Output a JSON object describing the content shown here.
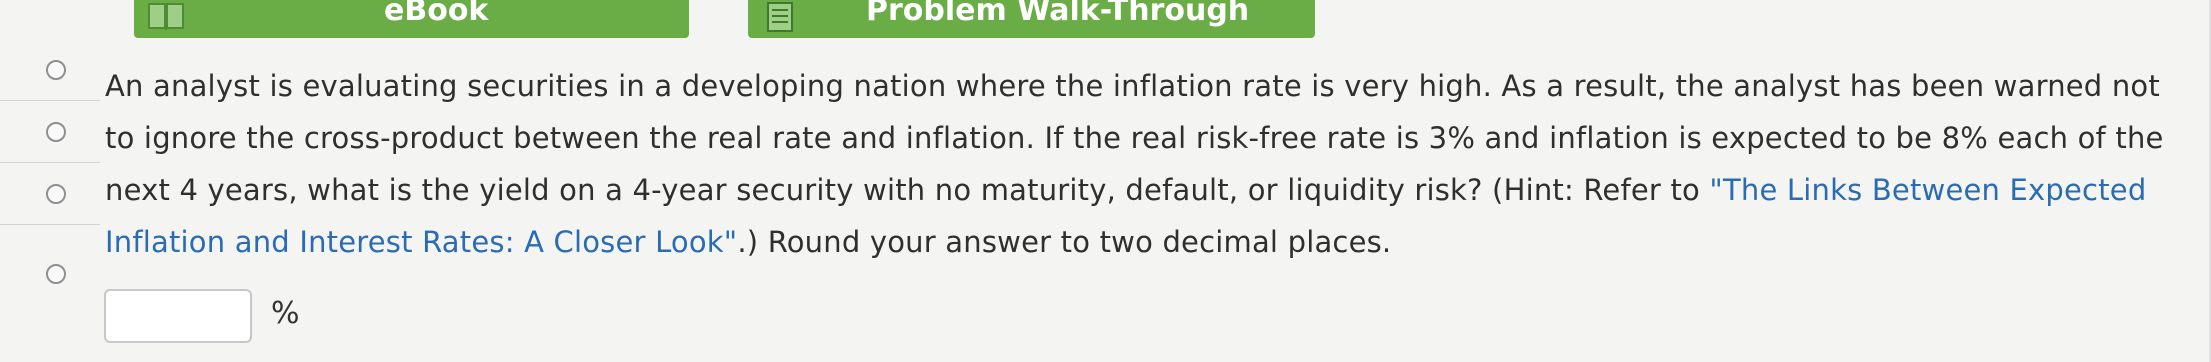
{
  "toolbar": {
    "ebook_label": "eBook",
    "walkthrough_label": "Problem Walk-Through"
  },
  "question": {
    "text_before_link": "An analyst is evaluating securities in a developing nation where the inflation rate is very high. As a result, the analyst has been warned not to ignore the cross-product between the real rate and inflation. If the real risk-free rate is 3% and inflation is expected to be 8% each of the next 4 years, what is the yield on a 4-year security with no maturity, default, or liquidity risk? (Hint: Refer to ",
    "link_text": "\"The Links Between Expected Inflation and Interest Rates: A Closer Look\"",
    "text_after_link": ".) Round your answer to two decimal places."
  },
  "answer": {
    "value": "",
    "unit": "%"
  },
  "colors": {
    "button_green": "#6aac45",
    "link_blue": "#2a6cb2"
  },
  "icons": [
    "book-icon",
    "document-icon"
  ]
}
